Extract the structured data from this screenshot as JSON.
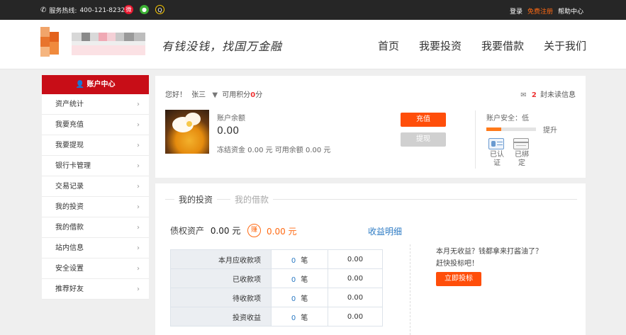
{
  "topbar": {
    "hotline_label": "服务热线:",
    "hotline_number": "400-121-8232",
    "social_icons": [
      "phone-icon",
      "weibo-icon",
      "wechat-icon",
      "qq-icon"
    ],
    "login": "登录",
    "register": "免费注册",
    "help": "帮助中心"
  },
  "header": {
    "slogan": "有钱没钱，找国万金融",
    "nav": [
      "首页",
      "我要投资",
      "我要借款",
      "关于我们"
    ]
  },
  "sidebar": {
    "title": "账户中心",
    "items": [
      "资产统计",
      "我要充值",
      "我要提现",
      "银行卡管理",
      "交易记录",
      "我的投资",
      "我的借款",
      "站内信息",
      "安全设置",
      "推荐好友"
    ]
  },
  "account": {
    "greeting": "您好！",
    "username": "张三",
    "points_label": "可用积分",
    "points_value": "0",
    "points_unit": "分",
    "unread_count": "2",
    "unread_label": "封未读信息",
    "balance_label": "账户余额",
    "balance_value": "0.00",
    "funds_detail": "冻结资金 0.00 元 可用余额 0.00 元",
    "recharge_button": "充值",
    "withdraw_button": "提现",
    "security_label": "账户安全：低",
    "security_level": 0.3,
    "upgrade_link": "提升",
    "verified_label_1": "已认",
    "verified_label_2": "证",
    "bound_label_1": "已绑",
    "bound_label_2": "定"
  },
  "invest": {
    "tab_invest": "我的投资",
    "tab_loan": "我的借款",
    "debt_label": "债权资产",
    "debt_value": "0.00 元",
    "earn_badge": "赚",
    "earn_value": "0.00 元",
    "earn_detail_link": "收益明细",
    "table": [
      {
        "label": "本月应收款项",
        "count": "0",
        "unit": "笔",
        "amount": "0.00"
      },
      {
        "label": "已收款项",
        "count": "0",
        "unit": "笔",
        "amount": "0.00"
      },
      {
        "label": "待收款项",
        "count": "0",
        "unit": "笔",
        "amount": "0.00"
      },
      {
        "label": "投资收益",
        "count": "0",
        "unit": "笔",
        "amount": "0.00"
      }
    ],
    "promo_line1": "本月无收益？钱都拿来打酱油了？",
    "promo_line2": "赶快投标吧！",
    "invest_now_button": "立即投标"
  },
  "colors": {
    "brand_red": "#c80d17",
    "accent_orange": "#ff4e0a",
    "link_blue": "#2d7bc4"
  }
}
